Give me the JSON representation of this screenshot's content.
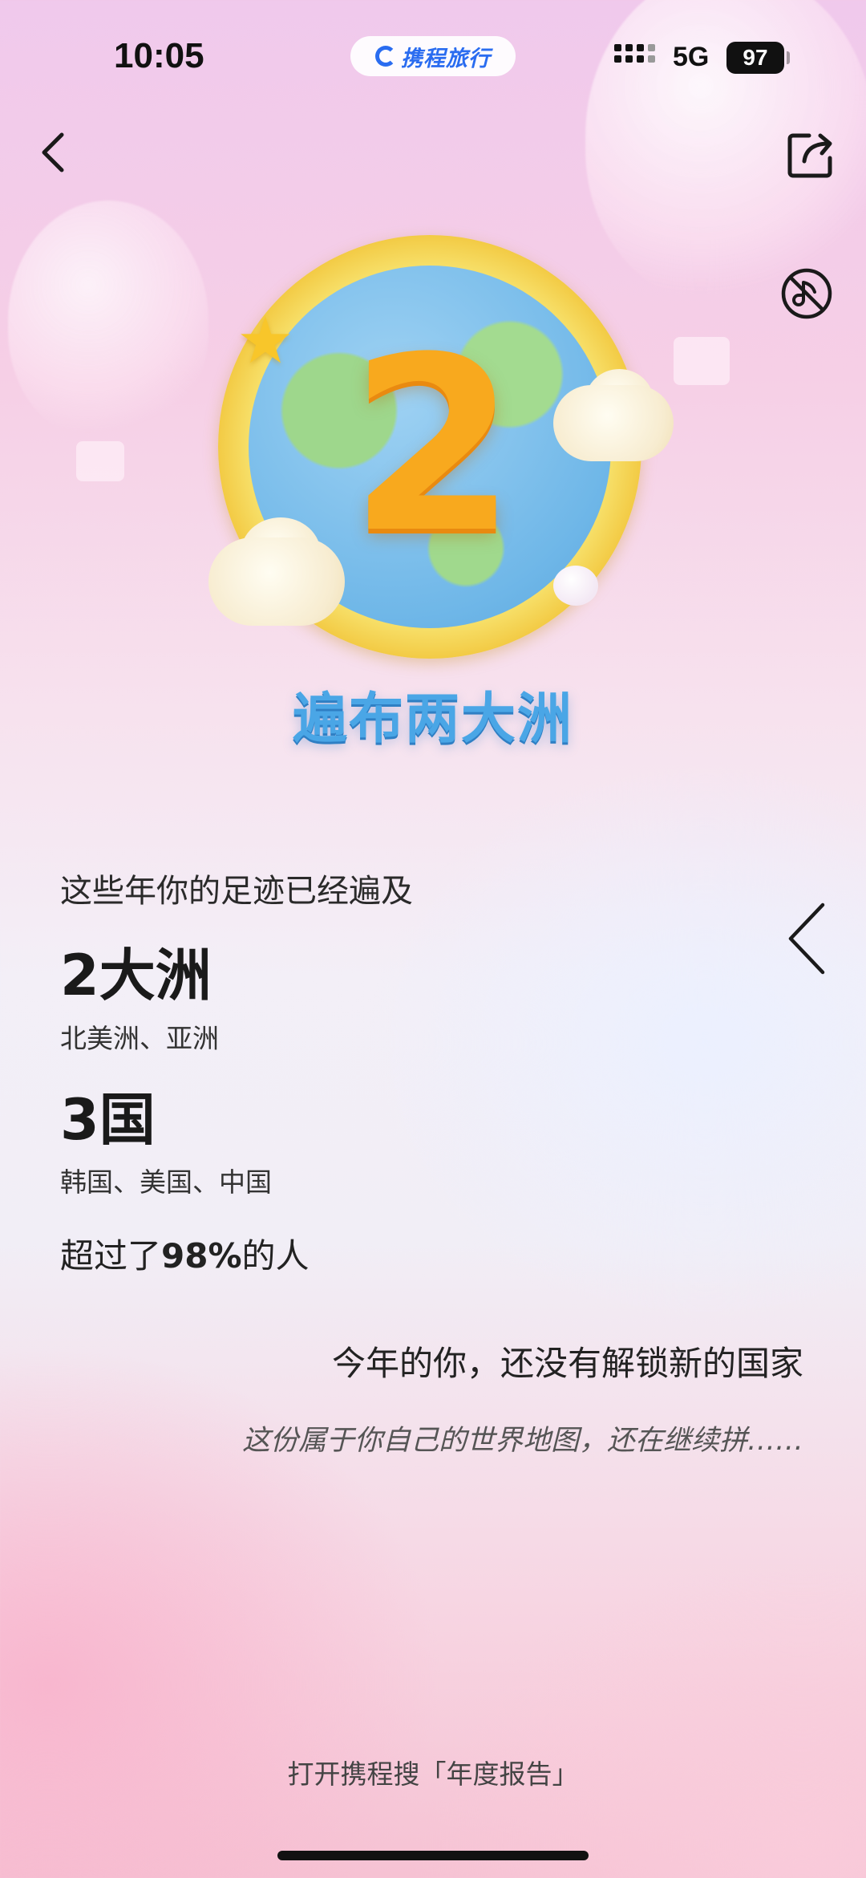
{
  "status_bar": {
    "time": "10:05",
    "app_name": "携程旅行",
    "network": "5G",
    "battery": "97"
  },
  "hero": {
    "number": "2",
    "caption": "遍布两大洲"
  },
  "stats": {
    "intro": "这些年你的足迹已经遍及",
    "continents_count": "2大洲",
    "continents_list": "北美洲、亚洲",
    "countries_count": "3国",
    "countries_list": "韩国、美国、中国",
    "percent_prefix": "超过了",
    "percent_value": "98%",
    "percent_suffix": "的人"
  },
  "message": {
    "unlock": "今年的你，还没有解锁新的国家",
    "puzzle": "这份属于你自己的世界地图，还在继续拼……"
  },
  "footer": {
    "hint": "打开携程搜「年度报告」"
  },
  "icons": {
    "back": "chevron-left-icon",
    "share": "share-icon",
    "music": "music-off-icon",
    "next": "chevron-left-icon"
  },
  "colors": {
    "brand_blue": "#2a6cf0",
    "caption_blue": "#4aa6e6",
    "number_orange": "#f8a91e"
  }
}
